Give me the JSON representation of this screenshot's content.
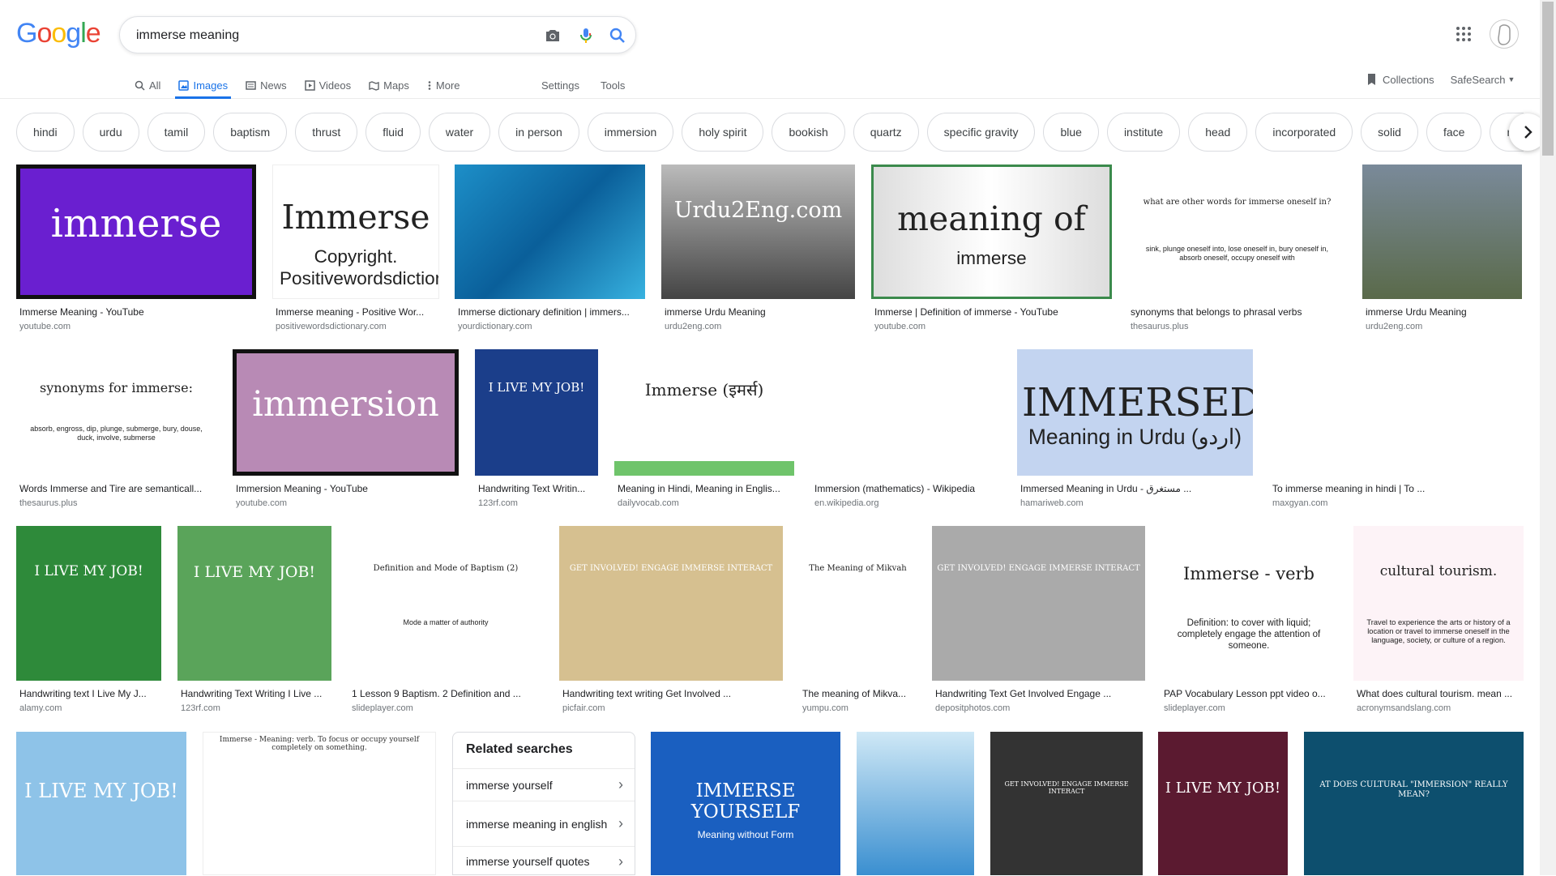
{
  "logo_text": "Google",
  "search": {
    "value": "immerse meaning"
  },
  "nav": {
    "all": "All",
    "images": "Images",
    "news": "News",
    "videos": "Videos",
    "maps": "Maps",
    "more": "More",
    "settings": "Settings",
    "tools": "Tools"
  },
  "header_right": {
    "collections": "Collections",
    "safesearch": "SafeSearch"
  },
  "chips": [
    "hindi",
    "urdu",
    "tamil",
    "baptism",
    "thrust",
    "fluid",
    "water",
    "in person",
    "immersion",
    "holy spirit",
    "bookish",
    "quartz",
    "specific gravity",
    "blue",
    "institute",
    "head",
    "incorporated",
    "solid",
    "face",
    "resources"
  ],
  "results": [
    {
      "caption": "Immerse Meaning - YouTube",
      "domain": "youtube.com",
      "thumb_text": "immerse"
    },
    {
      "caption": "Immerse meaning - Positive Wor...",
      "domain": "positivewordsdictionary.com",
      "thumb_text": "Immerse",
      "thumb_sub": "Copyright. Positivewordsdictionary.com"
    },
    {
      "caption": "Immerse dictionary definition | immers...",
      "domain": "yourdictionary.com"
    },
    {
      "caption": "immerse Urdu Meaning",
      "domain": "urdu2eng.com",
      "thumb_text": "Urdu2Eng.com"
    },
    {
      "caption": "Immerse | Definition of immerse - YouTube",
      "domain": "youtube.com",
      "thumb_text": "meaning of",
      "thumb_sub": "immerse"
    },
    {
      "caption": "synonyms that belongs to phrasal verbs",
      "domain": "thesaurus.plus",
      "thumb_text": "what are other words for immerse oneself in?",
      "thumb_sub": "sink, plunge oneself into, lose oneself in, bury oneself in, absorb oneself, occupy oneself with"
    },
    {
      "caption": "immerse Urdu Meaning",
      "domain": "urdu2eng.com"
    },
    {
      "caption": "Words Immerse and Tire are semanticall...",
      "domain": "thesaurus.plus",
      "thumb_text": "synonyms for immerse:",
      "thumb_sub": "absorb, engross, dip, plunge, submerge, bury, douse, duck, involve, submerse"
    },
    {
      "caption": "Immersion Meaning - YouTube",
      "domain": "youtube.com",
      "thumb_text": "immersion"
    },
    {
      "caption": "Handwriting Text Writin...",
      "domain": "123rf.com",
      "thumb_text": "I LIVE MY JOB!"
    },
    {
      "caption": "Meaning in Hindi, Meaning in Englis...",
      "domain": "dailyvocab.com",
      "thumb_text": "Immerse (इमर्स)"
    },
    {
      "caption": "Immersion (mathematics) - Wikipedia",
      "domain": "en.wikipedia.org"
    },
    {
      "caption": "Immersed Meaning in Urdu - مستغرق ...",
      "domain": "hamariweb.com",
      "thumb_text": "IMMERSED",
      "thumb_sub": "Meaning in Urdu (اردو)"
    },
    {
      "caption": "To immerse meaning in hindi | To ...",
      "domain": "maxgyan.com"
    },
    {
      "caption": "Handwriting text I Live My J...",
      "domain": "alamy.com",
      "thumb_text": "I LIVE MY JOB!"
    },
    {
      "caption": "Handwriting Text Writing I Live ...",
      "domain": "123rf.com",
      "thumb_text": "I LIVE MY JOB!"
    },
    {
      "caption": "1 Lesson 9 Baptism. 2 Definition and ...",
      "domain": "slideplayer.com",
      "thumb_text": "Definition and Mode of Baptism (2)",
      "thumb_sub": "Mode a matter of authority"
    },
    {
      "caption": "Handwriting text writing Get Involved ...",
      "domain": "picfair.com",
      "thumb_text": "GET INVOLVED! ENGAGE IMMERSE INTERACT"
    },
    {
      "caption": "The meaning of Mikva...",
      "domain": "yumpu.com",
      "thumb_text": "The Meaning of Mikvah"
    },
    {
      "caption": "Handwriting Text Get Involved Engage ...",
      "domain": "depositphotos.com",
      "thumb_text": "GET INVOLVED! ENGAGE IMMERSE INTERACT"
    },
    {
      "caption": "PAP Vocabulary Lesson ppt video o...",
      "domain": "slideplayer.com",
      "thumb_text": "Immerse - verb",
      "thumb_sub": "Definition: to cover with liquid; completely engage the attention of someone."
    },
    {
      "caption": "What does cultural tourism. mean ...",
      "domain": "acronymsandslang.com",
      "thumb_text": "cultural tourism.",
      "thumb_sub": "Travel to experience the arts or history of a location or travel to immerse oneself in the language, society, or culture of a region."
    }
  ],
  "row4": [
    {
      "thumb_text": "I LIVE MY JOB!"
    },
    {
      "thumb_text": "Immerse - Meaning: verb. To focus or occupy yourself completely on something."
    },
    {
      "thumb_text": "IMMERSE YOURSELF",
      "thumb_sub": "Meaning without Form"
    },
    {
      "thumb_text": ""
    },
    {
      "thumb_text": "GET INVOLVED! ENGAGE IMMERSE INTERACT"
    },
    {
      "thumb_text": "I LIVE MY JOB!"
    },
    {
      "thumb_text": "AT DOES CULTURAL \"IMMERSION\" REALLY MEAN?"
    }
  ],
  "related": {
    "title": "Related searches",
    "items": [
      "immerse yourself",
      "immerse meaning in english",
      "immerse yourself quotes"
    ]
  },
  "colors": {
    "accent": "#1a73e8",
    "purple": "#6a1fd0"
  }
}
